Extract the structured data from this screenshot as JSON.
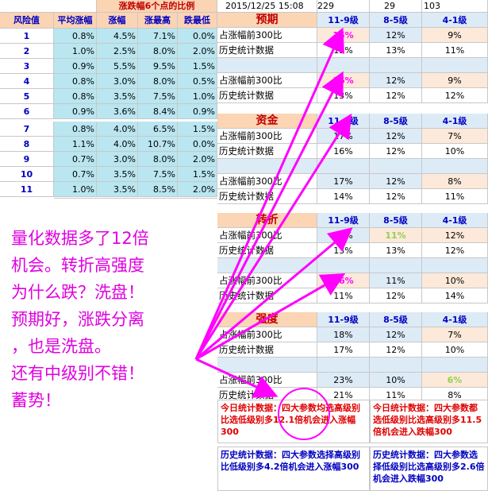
{
  "top": {
    "ratio_title": "涨跌幅6个点的比例",
    "datetime": "2015/12/25 15:08",
    "v1": "229",
    "v2": "29",
    "v3": "103"
  },
  "risk_table": {
    "headers": [
      "风险值",
      "平均涨幅",
      "涨幅",
      "涨最高",
      "跌最低"
    ],
    "rows": [
      {
        "id": "1",
        "avg": "0.8%",
        "rise": "4.5%",
        "high": "7.1%",
        "low": "0.0%"
      },
      {
        "id": "2",
        "avg": "1.0%",
        "rise": "2.5%",
        "high": "8.0%",
        "low": "2.0%"
      },
      {
        "id": "3",
        "avg": "0.9%",
        "rise": "5.5%",
        "high": "9.5%",
        "low": "1.5%"
      },
      {
        "id": "4",
        "avg": "0.8%",
        "rise": "3.0%",
        "high": "8.0%",
        "low": "0.5%"
      },
      {
        "id": "5",
        "avg": "0.8%",
        "rise": "3.5%",
        "high": "7.5%",
        "low": "1.0%"
      },
      {
        "id": "6",
        "avg": "0.9%",
        "rise": "3.6%",
        "high": "8.4%",
        "low": "0.9%"
      },
      {
        "id": "7",
        "avg": "0.8%",
        "rise": "4.0%",
        "high": "6.5%",
        "low": "1.5%"
      },
      {
        "id": "8",
        "avg": "1.1%",
        "rise": "4.0%",
        "high": "10.7%",
        "low": "0.0%"
      },
      {
        "id": "9",
        "avg": "0.7%",
        "rise": "3.0%",
        "high": "8.0%",
        "low": "2.0%"
      },
      {
        "id": "10",
        "avg": "0.7%",
        "rise": "3.5%",
        "high": "7.5%",
        "low": "1.5%"
      },
      {
        "id": "11",
        "avg": "1.0%",
        "rise": "3.5%",
        "high": "8.5%",
        "low": "2.0%"
      }
    ]
  },
  "levels": [
    "11-9级",
    "8-5级",
    "4-1级"
  ],
  "labels": {
    "top300": "占涨幅前300比",
    "hist": "历史统计数据"
  },
  "sections": [
    {
      "title": "预期",
      "g1": {
        "top300": [
          "15%",
          "12%",
          "9%"
        ],
        "hist": [
          "13%",
          "13%",
          "11%"
        ]
      },
      "g2": {
        "top300": [
          "16%",
          "12%",
          "9%"
        ],
        "hist": [
          "13%",
          "12%",
          "12%"
        ]
      }
    },
    {
      "title": "资金",
      "g1": {
        "top300": [
          "17%",
          "12%",
          "7%"
        ],
        "hist": [
          "16%",
          "12%",
          "10%"
        ]
      },
      "g2": {
        "top300": [
          "17%",
          "12%",
          "8%"
        ],
        "hist": [
          "14%",
          "12%",
          "11%"
        ]
      }
    },
    {
      "title": "转折",
      "g1": {
        "top300": [
          "14%",
          "11%",
          "12%"
        ],
        "hist": [
          "13%",
          "13%",
          "12%"
        ]
      },
      "g2": {
        "top300": [
          "16%",
          "11%",
          "10%"
        ],
        "hist": [
          "11%",
          "12%",
          "14%"
        ]
      }
    },
    {
      "title": "强度",
      "g1": {
        "top300": [
          "18%",
          "12%",
          "7%"
        ],
        "hist": [
          "17%",
          "12%",
          "10%"
        ]
      },
      "g2": {
        "top300": [
          "23%",
          "10%",
          "6%"
        ],
        "hist": [
          "21%",
          "11%",
          "8%"
        ]
      }
    }
  ],
  "notes": {
    "today_high": "今日统计数据：四大参数均选高级别比选低级别多12.1倍机会进入涨幅300",
    "today_low": "今日统计数据：四大参数都选低级别比选高级别多11.5倍机会进入跌幅300",
    "hist_high": "历史统计数据：四大参数选择高级别比低级别多4.2倍机会进入涨幅300",
    "hist_low": "历史统计数据：四大参数选择低级别比选高级别多2.6倍机会进入跌幅300"
  },
  "annotation": [
    "量化数据多了12倍",
    "机会。转折高强度",
    "为什么跌？洗盘！",
    "预期好，涨跌分离",
    "，也是洗盘。",
    "还有中级别不错！",
    "蓄势！"
  ],
  "colors": {
    "highlight_top": "#ff00ff",
    "highlight_mid": "#92d050",
    "arrow": "#ff00ff"
  }
}
